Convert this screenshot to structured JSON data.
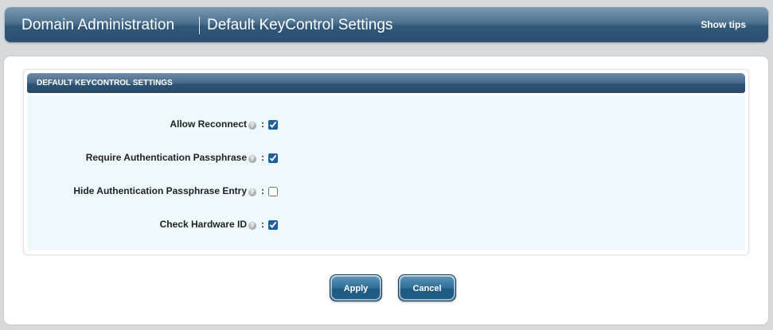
{
  "header": {
    "title": "Domain Administration",
    "subtitle": "Default KeyControl Settings",
    "tips_label": "Show tips"
  },
  "panel": {
    "title": "DEFAULT KEYCONTROL SETTINGS",
    "settings": [
      {
        "label": "Allow Reconnect",
        "help_icon": "help-icon",
        "checked": true
      },
      {
        "label": "Require Authentication Passphrase",
        "help_icon": "help-icon",
        "checked": true
      },
      {
        "label": "Hide Authentication Passphrase Entry",
        "help_icon": "help-icon",
        "checked": false
      },
      {
        "label": "Check Hardware ID",
        "help_icon": "help-icon",
        "checked": true
      }
    ]
  },
  "actions": {
    "apply_label": "Apply",
    "cancel_label": "Cancel"
  },
  "colors": {
    "header_blue": "#2b4f6f",
    "panel_body_bg": "#eef9fd",
    "button_blue": "#2f6f99"
  }
}
